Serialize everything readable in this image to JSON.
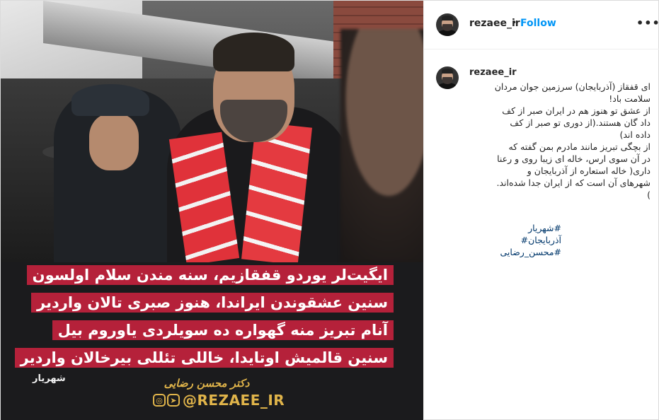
{
  "post": {
    "username": "rezaee_ir",
    "follow_label": "Follow",
    "more_label": "•••",
    "header_dot": "•",
    "comment_suffix": ".",
    "caption_lines": [
      "ای قفقاز (آذربایجان) سرزمین جوان مردان",
      "سلامت باد!",
      "از عشق تو هنوز هم در ایران صبر از کف",
      "داد گان هستند.(از دوری تو صبر از کف",
      "داده اند)",
      "از بچگی تبریز مانند مادرم بمن گفته که",
      "در آن سوی ارس، خاله ای زیبا روی و رعنا",
      "داری( خاله استعاره از آذربایجان و",
      "شهرهای آن است که از ایران جدا شده‌اند.",
      ")"
    ],
    "hashtags": [
      "#شهریار",
      "آذربایجان#",
      "#محسن_رضایی"
    ]
  },
  "image": {
    "banner_lines": [
      "ایگیت‌لر یوردو قفقازیم، سنه مندن سلام اولسون",
      "سنین عشقوندن ایراندا، هنوز صبری تالان واردیر",
      "آنام تبریز منه گهواره ده سویلردی یاوروم بیل",
      "سنین قالمیش اوتایدا، خاللی تئللی بیرخالان واردیر"
    ],
    "signer": "شهریار",
    "credit": "دکتر محسن رضایی",
    "brand": "@REZAEE_IR",
    "brand_icons": [
      "instagram-icon",
      "telegram-icon"
    ],
    "colors": {
      "banner": "#b5213a",
      "gold": "#e0b44a",
      "link": "#0095f6",
      "hashtag": "#00376b"
    }
  }
}
